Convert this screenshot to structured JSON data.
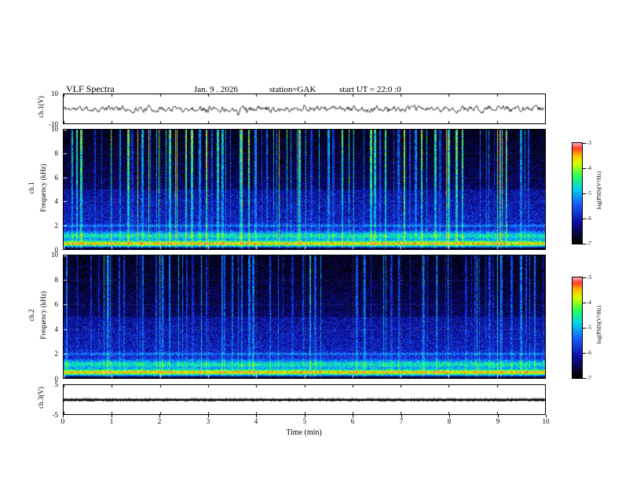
{
  "header": {
    "title": "VLF  Spectra",
    "date_label": "Jan. 9  . 2026",
    "station_label": "station=GAK",
    "start_label": "start UT  =   22:0   :0"
  },
  "xaxis": {
    "label": "Time  (min)",
    "min": 0,
    "max": 10,
    "ticks": [
      0,
      1,
      2,
      3,
      4,
      5,
      6,
      7,
      8,
      9,
      10
    ]
  },
  "colorbar": {
    "label": "log(PSD)(V²/Hz)",
    "ticks": [
      -3,
      -4,
      -5,
      -6,
      -7
    ],
    "top_value": -3,
    "bottom_value": -7,
    "colors_top_to_bottom": [
      "#ffa5b4",
      "#ff3c28",
      "#ffbe00",
      "#d7ff00",
      "#2dff50",
      "#00d7eb",
      "#1960ff",
      "#0c0ca5",
      "#06062d",
      "#000000"
    ]
  },
  "chart_data": [
    {
      "type": "line",
      "name": "ch1-waveform",
      "ylabel": "ch.1(V)",
      "ylim": [
        -10,
        10
      ],
      "yticks": [
        10,
        -10
      ],
      "series": [
        {
          "name": "ch.1 voltage",
          "description": "band-limited noise centered on 0 V, typical excursions ±2 V with occasional ±4 V spikes"
        }
      ],
      "noise": {
        "seed": 11,
        "smooth": 0.55,
        "amp_volts": 2.2
      }
    },
    {
      "type": "heatmap",
      "name": "ch1-spectrogram",
      "ylabel_line1": "ch.1",
      "ylabel_line2": "Frequency  (kHz)",
      "ylim": [
        0,
        10
      ],
      "yticks": [
        0,
        2,
        4,
        6,
        8,
        10
      ],
      "value_range_log_psd": [
        -7,
        -3
      ],
      "features": {
        "strong_band_khz": [
          0.3,
          1.0
        ],
        "secondary_band_khz": [
          1.0,
          1.6
        ],
        "thin_line_khz": 2.0,
        "vertical_streaks": "dense sferic streaks to 10 kHz, green/cyan with yellow cores",
        "background": "blue speckle below 5 kHz fading to near-black above"
      },
      "render": {
        "seed": 21,
        "streak_density": 0.52,
        "streak_gain": 1.0,
        "upper_boost": 0.75
      }
    },
    {
      "type": "heatmap",
      "name": "ch2-spectrogram",
      "ylabel_line1": "ch.2",
      "ylabel_line2": "Frequency  (kHz)",
      "ylim": [
        0,
        10
      ],
      "yticks": [
        0,
        2,
        4,
        6,
        8,
        10
      ],
      "value_range_log_psd": [
        -7,
        -3
      ],
      "features": {
        "strong_band_khz": [
          0.3,
          1.0
        ],
        "secondary_band_khz": [
          1.0,
          1.6
        ],
        "thin_line_khz": 2.0,
        "vertical_streaks": "moderate cyan/blue streaks across 1-10 kHz",
        "background": "blue speckle, slightly denser than ch.1 below 5 kHz"
      },
      "render": {
        "seed": 33,
        "streak_density": 0.42,
        "streak_gain": 0.72,
        "upper_boost": 0.45
      }
    },
    {
      "type": "line",
      "name": "ch3-trace",
      "ylabel": "ch.3(V)",
      "ylim": [
        -5,
        5
      ],
      "yticks": [
        5,
        -5
      ],
      "series": [
        {
          "name": "ch.3 voltage",
          "description": "flat thick trace at ≈0 V for full 10 min"
        }
      ],
      "noise": {
        "seed": 44,
        "smooth": 0,
        "amp_volts": 0.15
      }
    }
  ]
}
